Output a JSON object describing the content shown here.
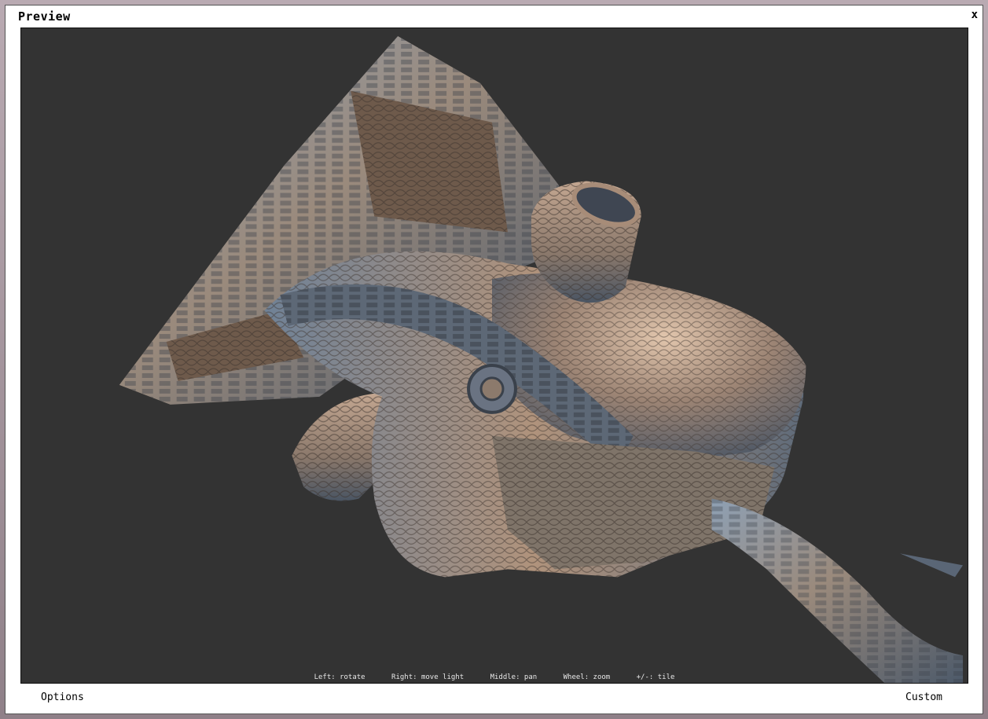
{
  "window": {
    "title": "Preview",
    "close_label": "x"
  },
  "viewport": {
    "hints": [
      "Left: rotate",
      "Right: move light",
      "Middle: pan",
      "Wheel: zoom",
      "+/-: tile"
    ],
    "background_color": "#333333"
  },
  "footer": {
    "options_label": "Options",
    "custom_label": "Custom"
  }
}
